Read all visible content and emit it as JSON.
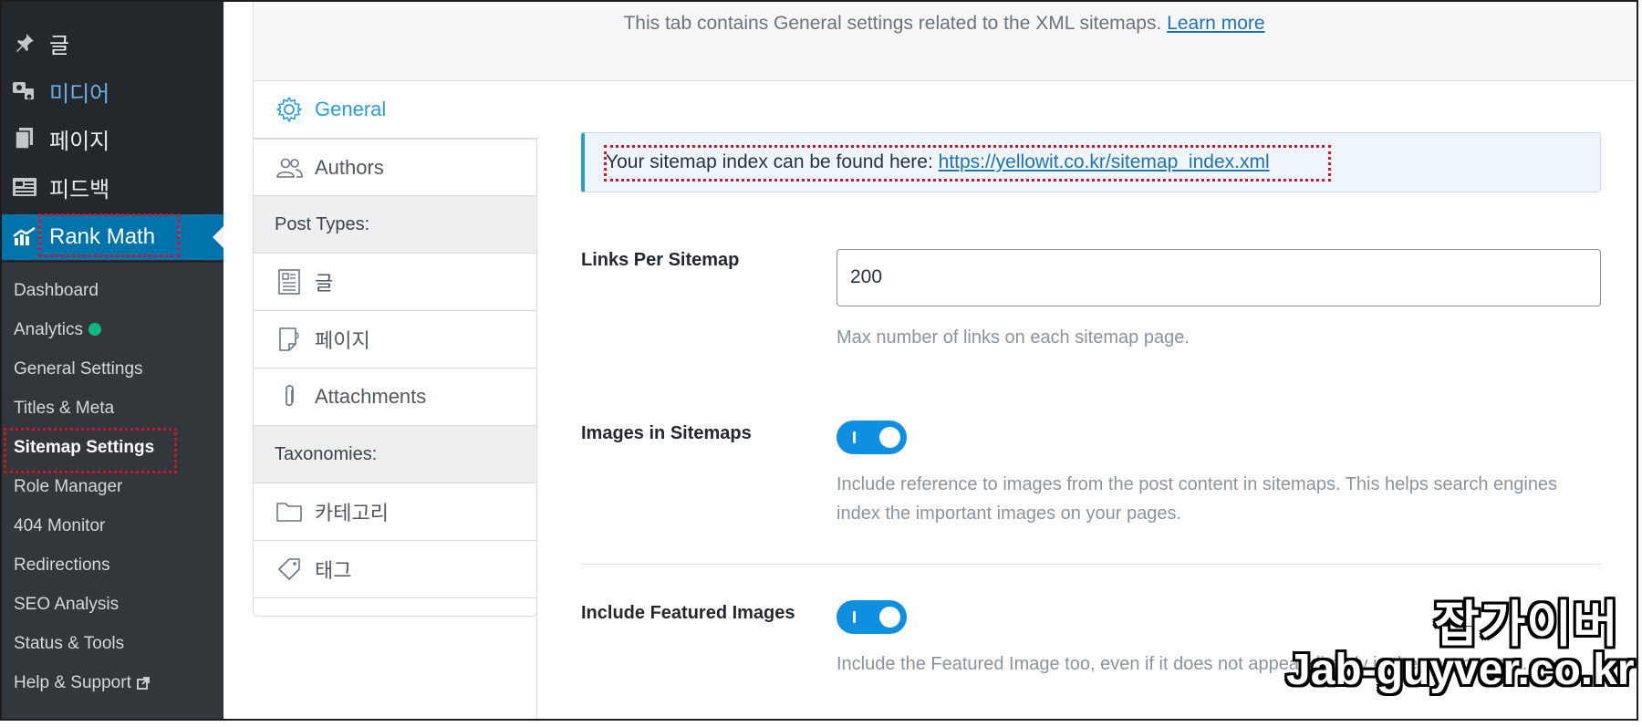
{
  "sidebar": {
    "menu": [
      {
        "label": "글",
        "icon": "pin-icon"
      },
      {
        "label": "미디어",
        "icon": "media-icon"
      },
      {
        "label": "페이지",
        "icon": "pages-icon"
      },
      {
        "label": "피드백",
        "icon": "feedback-icon"
      },
      {
        "label": "Rank Math",
        "icon": "rank-math-icon"
      }
    ],
    "submenu": [
      "Dashboard",
      "Analytics",
      "General Settings",
      "Titles & Meta",
      "Sitemap Settings",
      "Role Manager",
      "404 Monitor",
      "Redirections",
      "SEO Analysis",
      "Status & Tools",
      "Help & Support"
    ],
    "analytics_dot_color": "#10b981",
    "accent_color": "#0073aa"
  },
  "header": {
    "text": "This tab contains General settings related to the XML sitemaps.",
    "link": "Learn more"
  },
  "tabs": {
    "general": "General",
    "authors": "Authors",
    "post_types_header": "Post Types:",
    "posts": "글",
    "pages": "페이지",
    "attachments": "Attachments",
    "taxonomies_header": "Taxonomies:",
    "categories": "카테고리",
    "tags": "태그"
  },
  "notice": {
    "text": "Your sitemap index can be found here:",
    "link": "https://yellowit.co.kr/sitemap_index.xml"
  },
  "fields": {
    "links_per_sitemap": {
      "label": "Links Per Sitemap",
      "value": "200",
      "desc": "Max number of links on each sitemap page."
    },
    "images_in_sitemaps": {
      "label": "Images in Sitemaps",
      "enabled": true,
      "desc": "Include reference to images from the post content in sitemaps. This helps search engines index the important images on your pages."
    },
    "include_featured_images": {
      "label": "Include Featured Images",
      "enabled": true,
      "desc": "Include the Featured Image too, even if it does not appear directly in the post content."
    }
  },
  "watermark": {
    "line1": "잡가이버",
    "line2": "Jab-guyver.co.kr"
  }
}
